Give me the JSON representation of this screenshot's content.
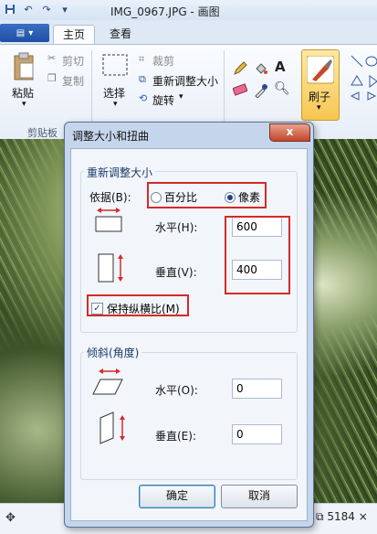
{
  "window": {
    "title": "IMG_0967.JPG - 画图",
    "qat_icons": [
      "save-icon",
      "undo-icon",
      "redo-icon",
      "customize-icon"
    ]
  },
  "ribbon": {
    "file_button_icon": "menu-icon",
    "tabs": [
      "主页",
      "查看"
    ],
    "clipboard": {
      "paste": "粘贴",
      "cut": "剪切",
      "copy": "复制",
      "group": "剪贴板"
    },
    "image": {
      "select": "选择",
      "crop": "裁剪",
      "resize": "重新调整大小",
      "rotate": "旋转"
    },
    "brushes": "刷子"
  },
  "status": {
    "size_text": "5184 ×"
  },
  "dialog": {
    "title": "调整大小和扭曲",
    "close_label": "x",
    "resize": {
      "legend": "重新调整大小",
      "by_label": "依据(B):",
      "options": [
        "百分比",
        "像素"
      ],
      "selected": "像素",
      "horizontal_label": "水平(H):",
      "horizontal_value": "600",
      "vertical_label": "垂直(V):",
      "vertical_value": "400",
      "keep_ratio_label": "保持纵横比(M)",
      "keep_ratio_checked": true
    },
    "skew": {
      "legend": "倾斜(角度)",
      "horizontal_label": "水平(O):",
      "horizontal_value": "0",
      "vertical_label": "垂直(E):",
      "vertical_value": "0"
    },
    "ok_label": "确定",
    "cancel_label": "取消"
  },
  "colors": {
    "highlight": "#d42a2a",
    "accent": "#1e4fa3"
  }
}
